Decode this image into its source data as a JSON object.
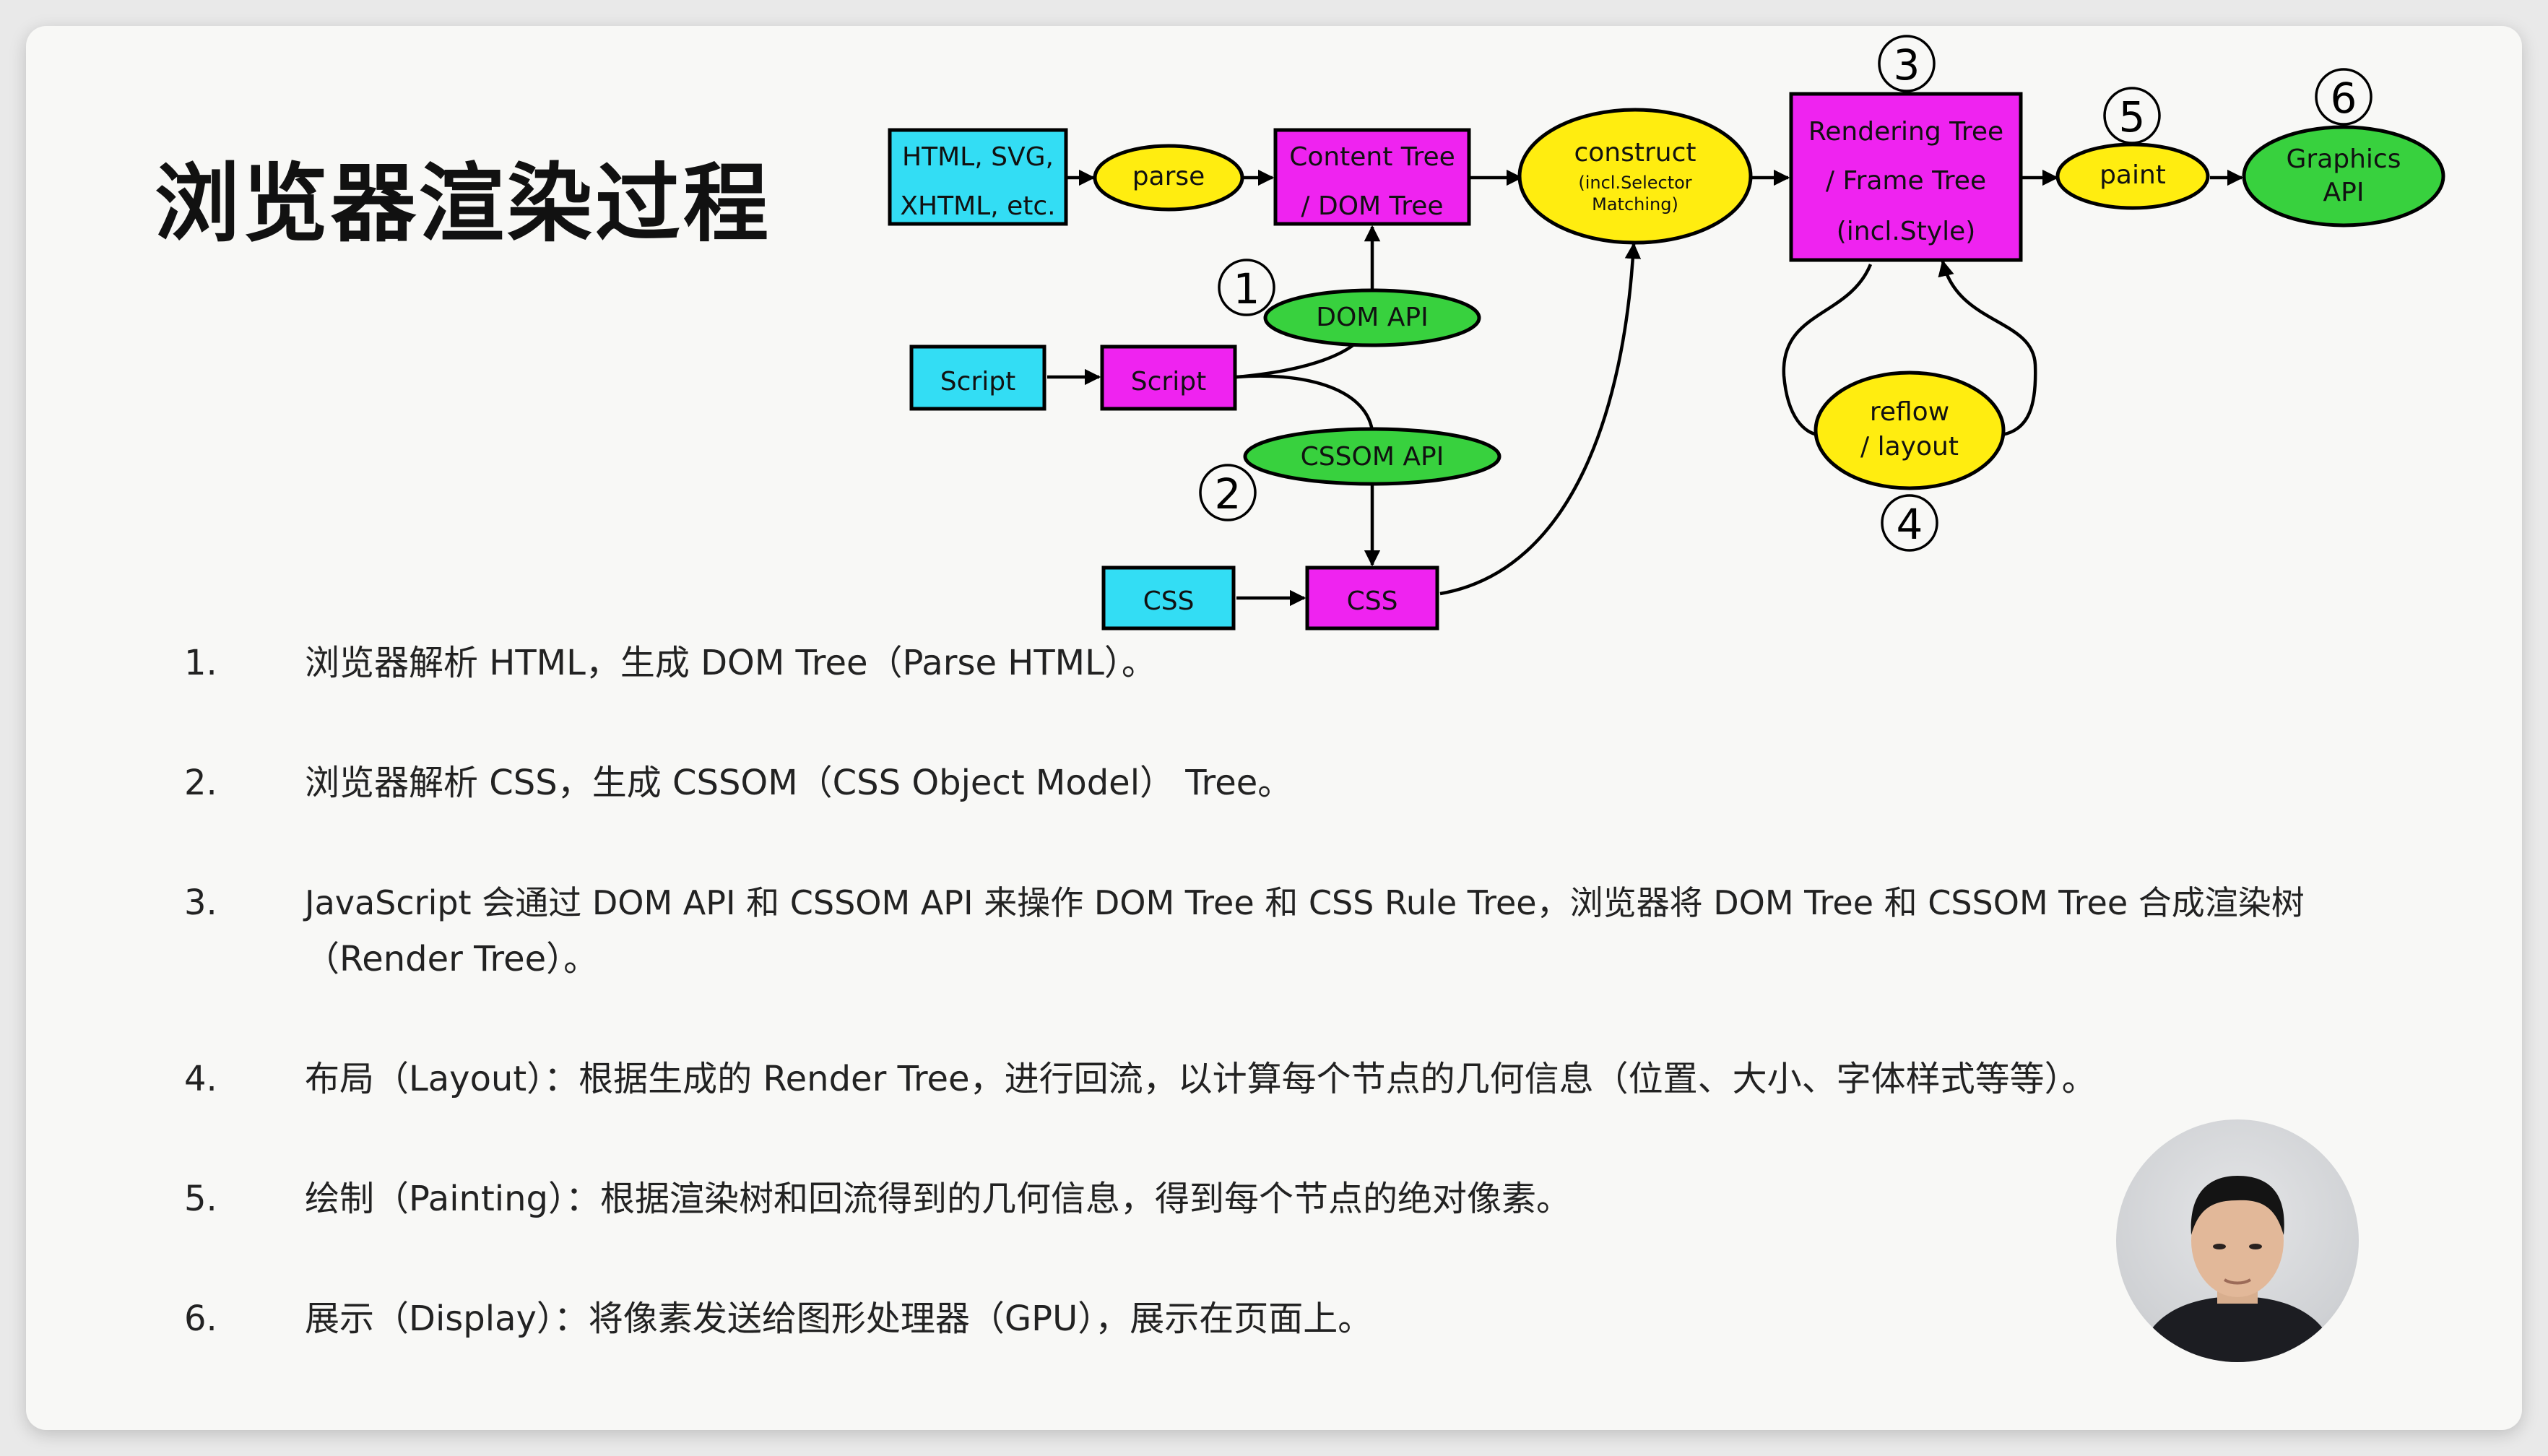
{
  "slide": {
    "title": "浏览器渲染过程"
  },
  "diagram": {
    "nodes": {
      "html_source": [
        "HTML, SVG,",
        "XHTML, etc."
      ],
      "parse": "parse",
      "content_tree": [
        "Content Tree",
        "/ DOM Tree"
      ],
      "construct": "construct",
      "construct_sub": [
        "(incl.Selector",
        "Matching)"
      ],
      "rendering_tree": [
        "Rendering Tree",
        "/ Frame Tree",
        "(incl.Style)"
      ],
      "paint": "paint",
      "graphics_api": [
        "Graphics",
        "API"
      ],
      "dom_api": "DOM API",
      "script_source": "Script",
      "script": "Script",
      "cssom_api": "CSSOM API",
      "css_source": "CSS",
      "css": "CSS",
      "reflow": [
        "reflow",
        "/ layout"
      ]
    },
    "step_markers": [
      "1",
      "2",
      "3",
      "4",
      "5",
      "6"
    ],
    "colors": {
      "source": "#33ddf4",
      "tree": "#ef23f0",
      "process": "#ffed10",
      "api": "#38d13e"
    }
  },
  "steps": [
    {
      "num": "1.",
      "text": "浏览器解析 HTML，生成 DOM Tree（Parse HTML）。"
    },
    {
      "num": "2.",
      "text": "浏览器解析 CSS，生成 CSSOM（CSS Object Model） Tree。"
    },
    {
      "num": "3.",
      "text": "JavaScript 会通过 DOM API 和 CSSOM API 来操作 DOM Tree 和 CSS Rule Tree，浏览器将 DOM Tree 和 CSSOM Tree 合成渲染树",
      "text2": "（Render Tree）。"
    },
    {
      "num": "4.",
      "text": "布局（Layout）：根据生成的 Render Tree，进行回流，以计算每个节点的几何信息（位置、大小、字体样式等等）。"
    },
    {
      "num": "5.",
      "text": "绘制（Painting）：根据渲染树和回流得到的几何信息，得到每个节点的绝对像素。"
    },
    {
      "num": "6.",
      "text": "展示（Display）：将像素发送给图形处理器（GPU），展示在页面上。"
    }
  ],
  "presenter": {
    "icon": "presenter-video-avatar"
  }
}
